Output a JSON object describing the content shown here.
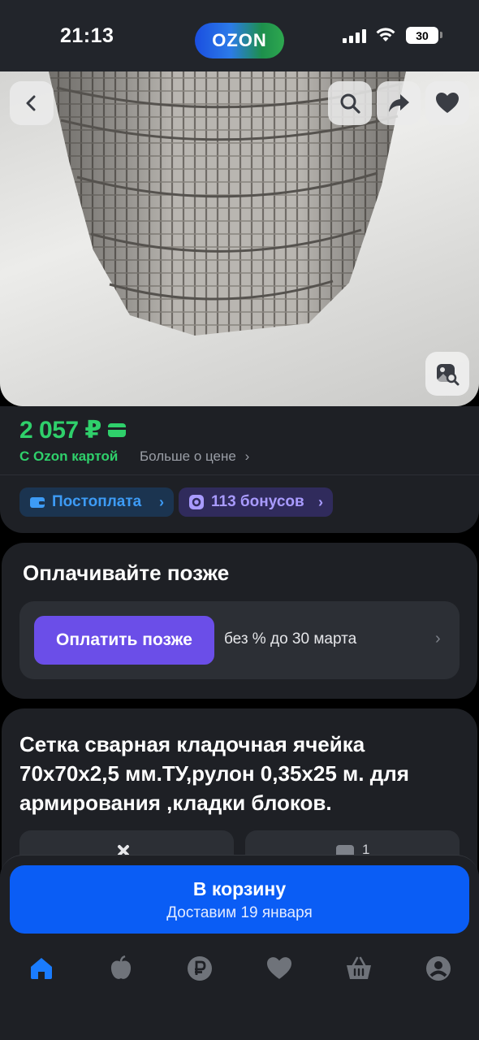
{
  "status_bar": {
    "time": "21:13",
    "logo": "OZON",
    "battery": "30"
  },
  "product_image": {
    "icons": [
      "back-icon",
      "search-icon",
      "share-icon",
      "heart-icon",
      "image-search-icon"
    ]
  },
  "price": {
    "value": "2 057 ₽",
    "with_card": "С Ozon картой",
    "more_link": "Больше о цене",
    "chips": [
      {
        "label": "Постоплата"
      },
      {
        "label": "113 бонусов"
      }
    ]
  },
  "pay_later": {
    "title": "Оплачивайте позже",
    "button": "Оплатить позже",
    "text": "без % до 30 марта"
  },
  "product": {
    "title": "Сетка сварная кладочная ячейка 70х70х2,5 мм.ТУ,рулон 0,35х25 м. для армирования ,кладки блоков.",
    "questions_count": "1"
  },
  "cart": {
    "label": "В корзину",
    "delivery": "Доставим 19 января"
  },
  "colors": {
    "accent": "#0a5df5",
    "price_green": "#2fd06b",
    "purple": "#6b4ee8",
    "card_bg": "#1e2025"
  },
  "nav": [
    "home-icon",
    "fresh-icon",
    "ruble-icon",
    "favorites-icon",
    "cart-icon",
    "profile-icon"
  ]
}
